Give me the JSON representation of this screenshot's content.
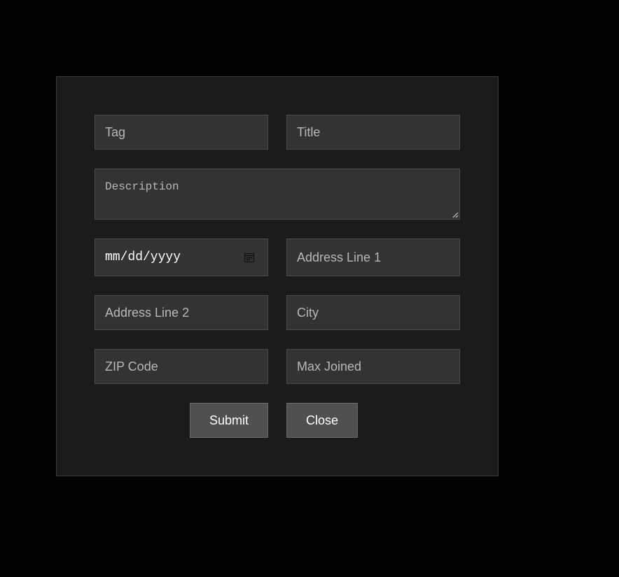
{
  "form": {
    "tag_placeholder": "Tag",
    "title_placeholder": "Title",
    "description_placeholder": "Description",
    "date_placeholder": "mm/dd/yyyy",
    "address1_placeholder": "Address Line 1",
    "address2_placeholder": "Address Line 2",
    "city_placeholder": "City",
    "zip_placeholder": "ZIP Code",
    "max_joined_placeholder": "Max Joined",
    "submit_label": "Submit",
    "close_label": "Close"
  },
  "colors": {
    "page_background": "#000000",
    "modal_background": "#1b1b1b",
    "field_background": "#333333",
    "button_background": "#505050"
  },
  "icons": {
    "date_icon": "calendar-icon",
    "textarea_icon": "resize-handle-icon"
  }
}
